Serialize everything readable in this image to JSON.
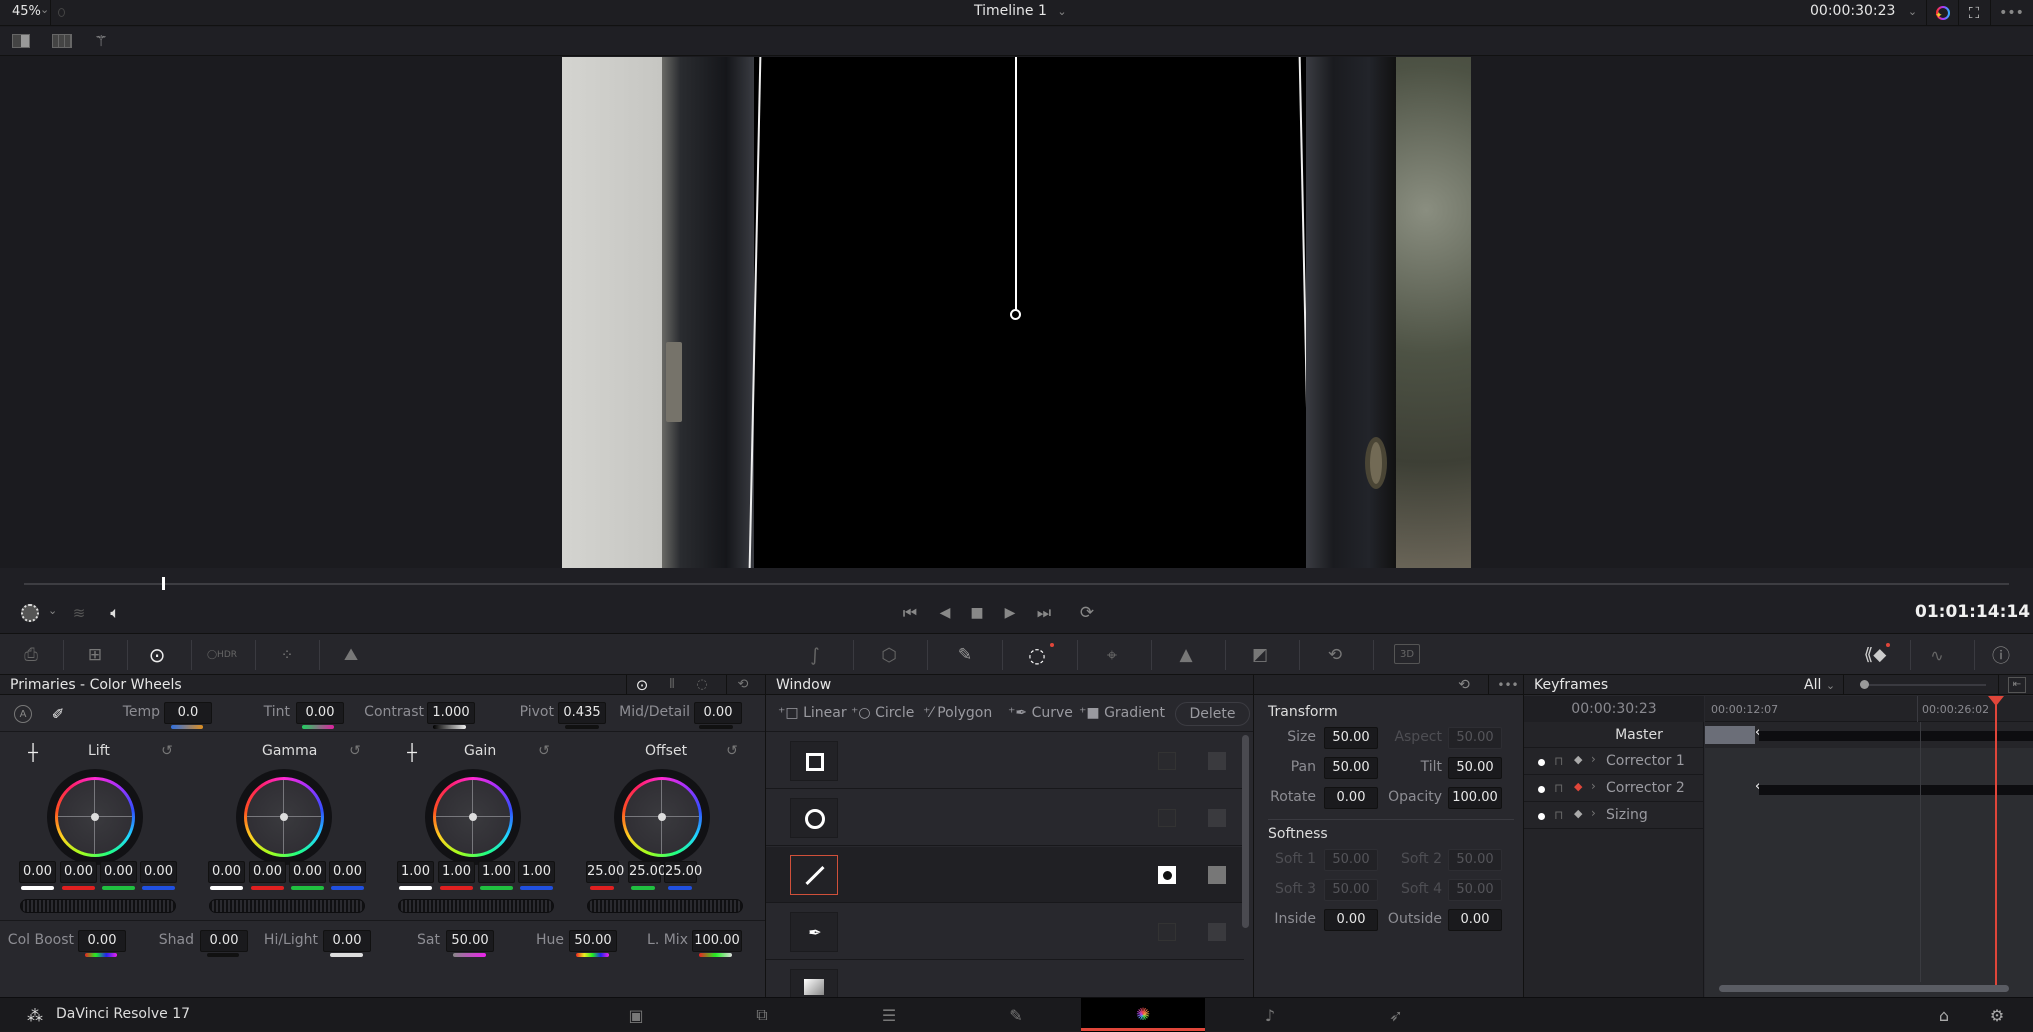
{
  "app": {
    "name": "DaVinci Resolve 17"
  },
  "topbar": {
    "zoom": "45%",
    "timeline_title": "Timeline 1",
    "timecode": "00:00:30:23"
  },
  "viewer": {
    "scrubber_position": 0.07
  },
  "transport": {
    "timecode": "01:01:14:14"
  },
  "primaries": {
    "title": "Primaries - Color Wheels",
    "params_top": [
      {
        "label": "Temp",
        "value": "0.0"
      },
      {
        "label": "Tint",
        "value": "0.00"
      },
      {
        "label": "Contrast",
        "value": "1.000"
      },
      {
        "label": "Pivot",
        "value": "0.435"
      },
      {
        "label": "Mid/Detail",
        "value": "0.00"
      }
    ],
    "wheels": [
      {
        "name": "Lift",
        "values": [
          "0.00",
          "0.00",
          "0.00",
          "0.00"
        ]
      },
      {
        "name": "Gamma",
        "values": [
          "0.00",
          "0.00",
          "0.00",
          "0.00"
        ]
      },
      {
        "name": "Gain",
        "values": [
          "1.00",
          "1.00",
          "1.00",
          "1.00"
        ]
      },
      {
        "name": "Offset",
        "values": [
          "25.00",
          "25.00",
          "25.00"
        ]
      }
    ],
    "params_bottom": [
      {
        "label": "Col Boost",
        "value": "0.00"
      },
      {
        "label": "Shad",
        "value": "0.00"
      },
      {
        "label": "Hi/Light",
        "value": "0.00"
      },
      {
        "label": "Sat",
        "value": "50.00"
      },
      {
        "label": "Hue",
        "value": "50.00"
      },
      {
        "label": "L. Mix",
        "value": "100.00"
      }
    ]
  },
  "window_panel": {
    "title": "Window",
    "tools": [
      "Linear",
      "Circle",
      "Polygon",
      "Curve",
      "Gradient"
    ],
    "delete_label": "Delete",
    "shapes": [
      {
        "shape": "square-icon",
        "active": false
      },
      {
        "shape": "circle-icon",
        "active": false
      },
      {
        "shape": "line-icon",
        "active": true
      },
      {
        "shape": "pen-icon",
        "active": false
      },
      {
        "shape": "gradient-icon",
        "active": false
      }
    ]
  },
  "transform": {
    "title": "Transform",
    "fields": [
      {
        "label": "Size",
        "value": "50.00",
        "enabled": true
      },
      {
        "label": "Aspect",
        "value": "50.00",
        "enabled": false
      },
      {
        "label": "Pan",
        "value": "50.00",
        "enabled": true
      },
      {
        "label": "Tilt",
        "value": "50.00",
        "enabled": true
      },
      {
        "label": "Rotate",
        "value": "0.00",
        "enabled": true
      },
      {
        "label": "Opacity",
        "value": "100.00",
        "enabled": true
      }
    ],
    "softness_title": "Softness",
    "softness": [
      {
        "label": "Soft 1",
        "value": "50.00",
        "enabled": false
      },
      {
        "label": "Soft 2",
        "value": "50.00",
        "enabled": false
      },
      {
        "label": "Soft 3",
        "value": "50.00",
        "enabled": false
      },
      {
        "label": "Soft 4",
        "value": "50.00",
        "enabled": false
      },
      {
        "label": "Inside",
        "value": "0.00",
        "enabled": true
      },
      {
        "label": "Outside",
        "value": "0.00",
        "enabled": true
      }
    ]
  },
  "keyframes": {
    "title": "Keyframes",
    "filter": "All",
    "current_time": "00:00:30:23",
    "ruler": [
      "00:00:12:07",
      "00:00:26:02"
    ],
    "tracks": [
      {
        "name": "Master"
      },
      {
        "name": "Corrector 1",
        "keyed": false
      },
      {
        "name": "Corrector 2",
        "keyed": true
      },
      {
        "name": "Sizing",
        "keyed": false
      }
    ],
    "accent": "#e0463a"
  },
  "pages": [
    "Media",
    "Cut",
    "Edit",
    "Fusion",
    "Color",
    "Fairlight",
    "Deliver"
  ],
  "active_page": "Color"
}
